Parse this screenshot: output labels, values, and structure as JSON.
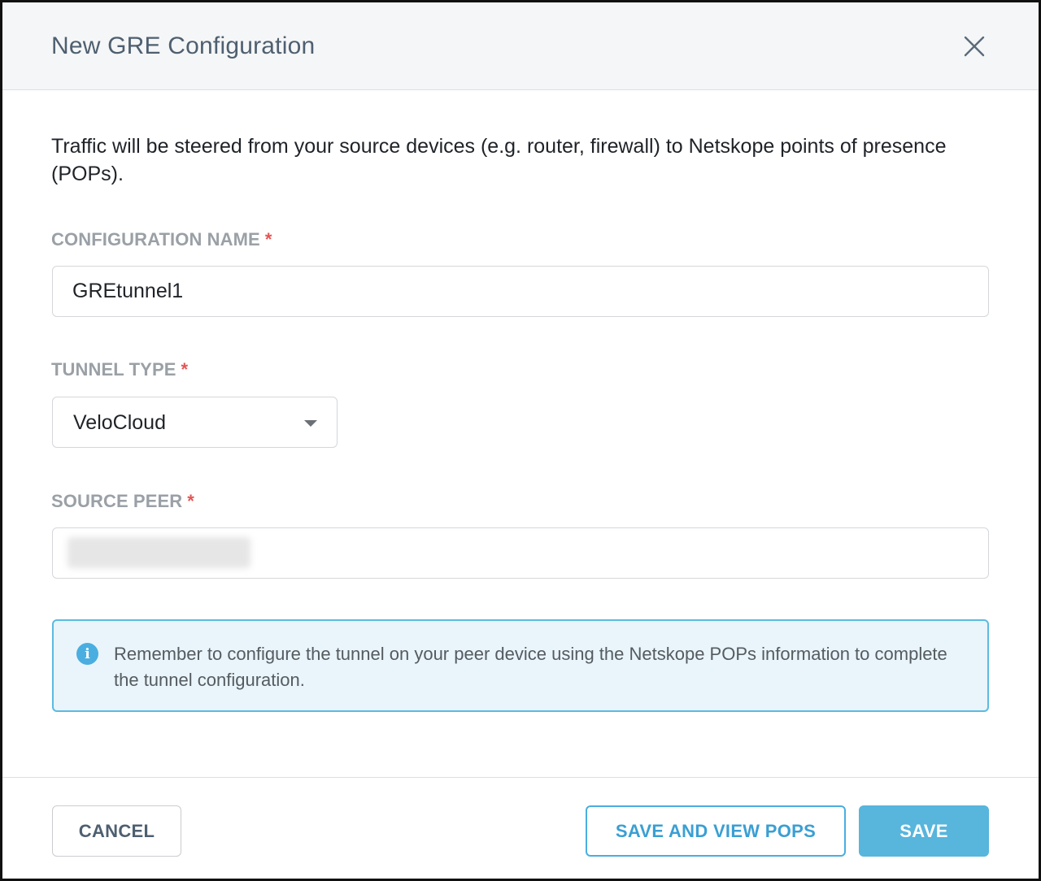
{
  "dialog": {
    "title": "New GRE Configuration",
    "close_icon": "close-icon",
    "intro": "Traffic will be steered from your source devices (e.g. router, firewall) to Netskope points of presence (POPs)."
  },
  "fields": {
    "config_name": {
      "label": "CONFIGURATION NAME",
      "required_mark": "*",
      "value": "GREtunnel1"
    },
    "tunnel_type": {
      "label": "TUNNEL TYPE",
      "required_mark": "*",
      "selected": "VeloCloud",
      "icon": "chevron-down-icon"
    },
    "source_peer": {
      "label": "SOURCE PEER",
      "required_mark": "*",
      "value": ""
    }
  },
  "info": {
    "icon": "info-icon",
    "text": "Remember to configure the tunnel on your peer device using the Netskope POPs information to complete the tunnel configuration."
  },
  "buttons": {
    "cancel": "CANCEL",
    "save_and_view": "SAVE AND VIEW POPS",
    "save": "SAVE"
  },
  "colors": {
    "accent": "#4aaee0",
    "required": "#e25555",
    "info_bg": "#e9f5fa"
  }
}
